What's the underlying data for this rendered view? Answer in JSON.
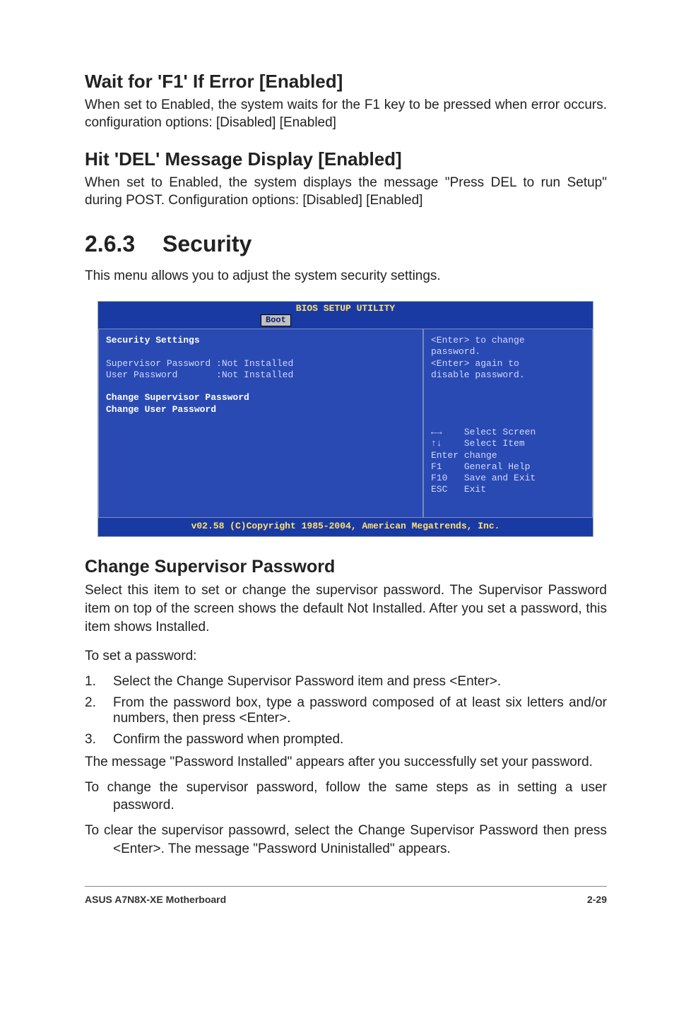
{
  "h1": {
    "title": "Wait for 'F1' If Error [Enabled]",
    "body": "When set to Enabled, the system waits for the F1 key to be pressed when error occurs. configuration options: [Disabled] [Enabled]"
  },
  "h2": {
    "title": "Hit 'DEL' Message Display [Enabled]",
    "body": "When set to Enabled, the system displays the message \"Press DEL to run Setup\" during POST. Configuration options: [Disabled] [Enabled]"
  },
  "section": {
    "num": "2.6.3",
    "title": "Security"
  },
  "intro": "This menu allows you to adjust the system security settings.",
  "bios": {
    "title": "BIOS SETUP UTILITY",
    "tab": "Boot",
    "left": {
      "heading": "Security Settings",
      "row1a": "Supervisor Password :",
      "row1b": "Not Installed",
      "row2a": "User Password       :",
      "row2b": "Not Installed",
      "opt1": "Change Supervisor Password",
      "opt2": "Change User Password"
    },
    "right": {
      "l1": "<Enter> to change",
      "l2": "password.",
      "l3": "<Enter> again to",
      "l4": "disable password.",
      "nav1k": "←→",
      "nav1v": "Select Screen",
      "nav2k": "↑↓",
      "nav2v": "Select Item",
      "nav3k": "Enter",
      "nav3v": "change",
      "nav4k": "F1",
      "nav4v": "General Help",
      "nav5k": "F10",
      "nav5v": "Save and Exit",
      "nav6k": "ESC",
      "nav6v": "Exit"
    },
    "foot": "v02.58 (C)Copyright 1985-2004, American Megatrends, Inc."
  },
  "csp": {
    "title": "Change Supervisor Password",
    "p1": "Select this item to set or change the supervisor password. The Supervisor Password item on top of the screen shows the default Not Installed. After you set a password, this item shows Installed.",
    "lead": "To set a password:",
    "steps": [
      "Select the Change Supervisor Password item and press <Enter>.",
      "From the password box, type a password composed of at least six letters and/or numbers, then press <Enter>.",
      "Confirm the password when prompted."
    ],
    "after1": "The message \"Password Installed\" appears after you successfully set your password.",
    "after2": "To change the supervisor password, follow the same steps as in setting a user password.",
    "after3": "To clear the supervisor passowrd, select the Change Supervisor Password then press <Enter>. The message \"Password Uninistalled\" appears."
  },
  "footer": {
    "left": "ASUS A7N8X-XE Motherboard",
    "right": "2-29"
  }
}
